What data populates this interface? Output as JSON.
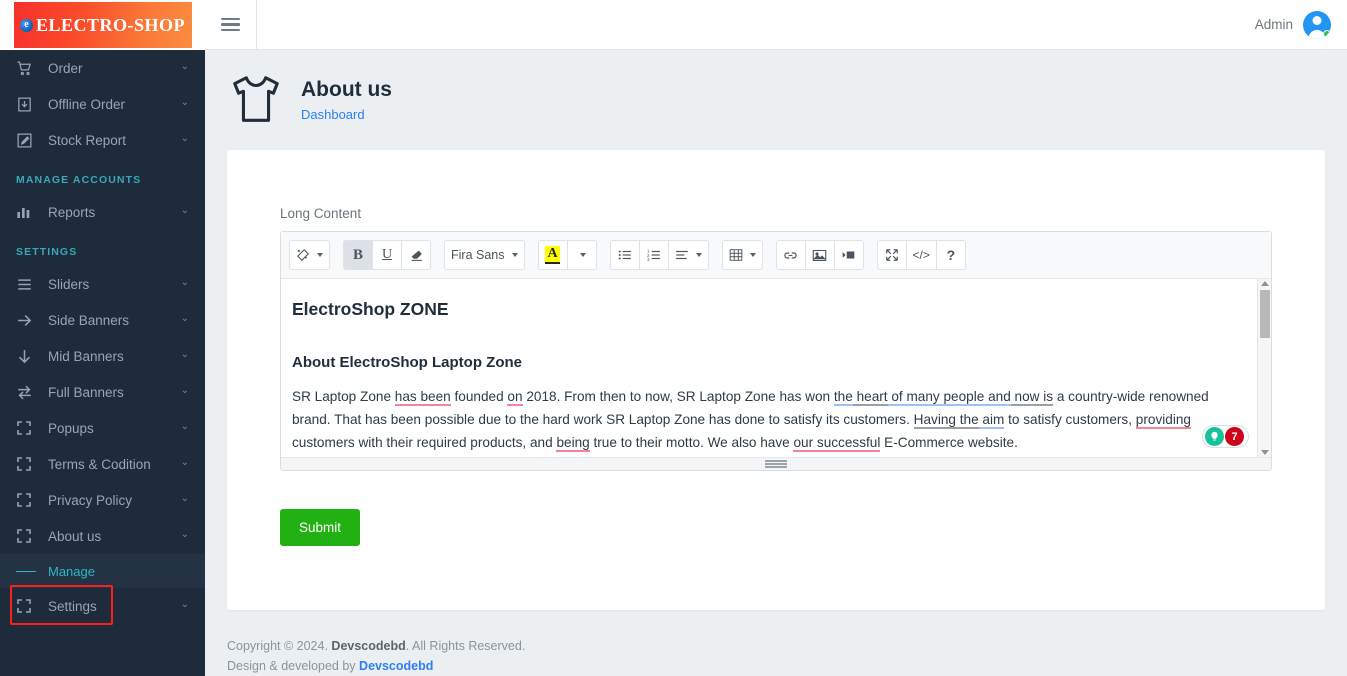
{
  "brand": {
    "logo_text": "ELECTRO-SHOP",
    "logo_mark": "e",
    "logo_gradient_from": "#f8312b",
    "logo_gradient_to": "#fb8c3f"
  },
  "sidebar": {
    "items": [
      {
        "label": "Order",
        "icon": "cart-icon",
        "chevron": "⌄"
      },
      {
        "label": "Offline Order",
        "icon": "download-box-icon",
        "chevron": "⌄"
      },
      {
        "label": "Stock Report",
        "icon": "edit-square-icon",
        "chevron": "⌄"
      }
    ],
    "section_manage_accounts": "MANAGE ACCOUNTS",
    "reports": {
      "label": "Reports",
      "icon": "bar-chart-icon",
      "chevron": "⌄"
    },
    "section_settings": "SETTINGS",
    "settings_items": [
      {
        "label": "Sliders",
        "icon": "sliders-icon",
        "chevron": "⌄"
      },
      {
        "label": "Side Banners",
        "icon": "arrow-right-icon",
        "chevron": "⌄"
      },
      {
        "label": "Mid Banners",
        "icon": "arrow-down-icon",
        "chevron": "⌄"
      },
      {
        "label": "Full Banners",
        "icon": "arrows-exchange-icon",
        "chevron": "⌄"
      },
      {
        "label": "Popups",
        "icon": "expand-icon",
        "chevron": "⌄"
      },
      {
        "label": "Terms & Codition",
        "icon": "expand-icon",
        "chevron": "⌄"
      },
      {
        "label": "Privacy Policy",
        "icon": "expand-icon",
        "chevron": "⌄"
      },
      {
        "label": "About us",
        "icon": "expand-icon",
        "chevron": "⌄"
      }
    ],
    "active_sub": "Manage",
    "last_item": {
      "label": "Settings",
      "icon": "expand-icon",
      "chevron": "⌄"
    },
    "bg_color": "#1d2b3a",
    "accent_color": "#2fb6c9",
    "annotation_color": "#fb1f1f"
  },
  "topbar": {
    "menu_toggle": "hamburger-icon",
    "admin_label": "Admin",
    "status": "online"
  },
  "pagehead": {
    "icon": "tshirt-icon",
    "title": "About us",
    "breadcrumb": "Dashboard"
  },
  "form": {
    "field_label": "Long Content",
    "submit_label": "Submit",
    "submit_color": "#22b112"
  },
  "editor": {
    "toolbar": [
      {
        "name": "style-magic-wand",
        "glyph": "✨",
        "caret": true
      },
      {
        "name": "bold",
        "glyph": "B",
        "active": true
      },
      {
        "name": "underline",
        "glyph": "U"
      },
      {
        "name": "remove-format-eraser",
        "glyph": "▬"
      },
      {
        "name": "font-family",
        "glyph": "Fira Sans",
        "caret": true
      },
      {
        "name": "text-highlight-color",
        "glyph": "A"
      },
      {
        "name": "text-color-dropdown",
        "glyph": "",
        "caret": true
      },
      {
        "name": "unordered-list",
        "glyph": "☰"
      },
      {
        "name": "ordered-list",
        "glyph": "☲"
      },
      {
        "name": "paragraph-align",
        "glyph": "≡",
        "caret": true
      },
      {
        "name": "table",
        "glyph": "▦",
        "caret": true
      },
      {
        "name": "insert-link",
        "glyph": "🔗"
      },
      {
        "name": "insert-image",
        "glyph": "🖼"
      },
      {
        "name": "insert-video",
        "glyph": "▶"
      },
      {
        "name": "fullscreen",
        "glyph": "⤢"
      },
      {
        "name": "code-view",
        "glyph": "</>"
      },
      {
        "name": "help",
        "glyph": "?"
      }
    ],
    "font_family_value": "Fira Sans",
    "content": {
      "heading1": "ElectroShop ZONE",
      "heading2": "About ElectroShop Laptop Zone",
      "paragraph_segments": [
        {
          "text": "SR Laptop Zone ",
          "mark": "none"
        },
        {
          "text": "has been",
          "mark": "red"
        },
        {
          "text": " founded ",
          "mark": "none"
        },
        {
          "text": "on",
          "mark": "red"
        },
        {
          "text": " 2018. From then to now, SR Laptop Zone has won ",
          "mark": "none"
        },
        {
          "text": "the",
          "mark": "blue"
        },
        {
          "text": " heart",
          "mark": "gray"
        },
        {
          "text": " of many people and",
          "mark": "blue"
        },
        {
          "text": " now is",
          "mark": "gray"
        },
        {
          "text": " a country-wide renowned brand. That has been possible due to the hard work SR Laptop Zone has done to satisfy its customers. ",
          "mark": "none"
        },
        {
          "text": "Having the",
          "mark": "gray"
        },
        {
          "text": " aim",
          "mark": "blue"
        },
        {
          "text": " to satisfy customers, ",
          "mark": "none"
        },
        {
          "text": "providing",
          "mark": "red"
        },
        {
          "text": " customers with their required products, and ",
          "mark": "none"
        },
        {
          "text": "being",
          "mark": "red"
        },
        {
          "text": " true to their motto. We also have ",
          "mark": "none"
        },
        {
          "text": "our successful",
          "mark": "red"
        },
        {
          "text": " E-Commerce website.",
          "mark": "none"
        }
      ]
    },
    "grammarly": {
      "icon": "lightbulb-icon",
      "suggestion_count": "7",
      "bulb_color": "#15c39a",
      "badge_color": "#d0021b"
    },
    "resize_handle": "resize-grip-icon",
    "scrollbar": "vertical-scrollbar"
  },
  "footer": {
    "copyright_prefix": "Copyright © 2024.",
    "company": "Devscodebd",
    "copyright_suffix": "All Rights Reserved.",
    "credit_prefix": "Design & developed by",
    "credit_company": "Devscodebd"
  }
}
